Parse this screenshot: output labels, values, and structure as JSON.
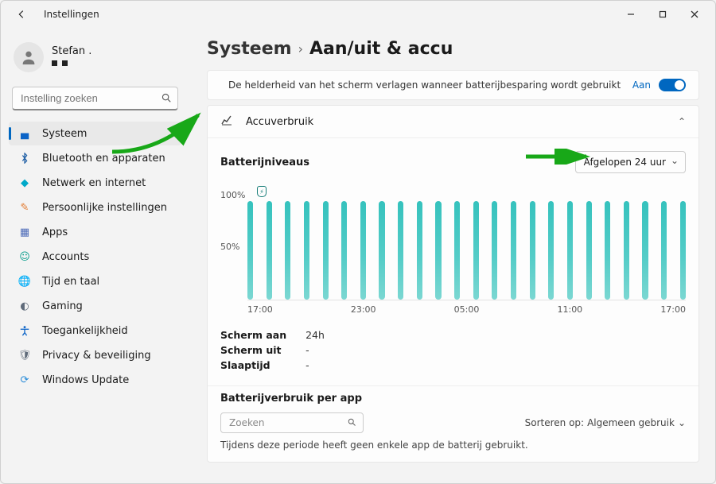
{
  "titlebar": {
    "title": "Instellingen"
  },
  "account": {
    "name": "Stefan ."
  },
  "search": {
    "placeholder": "Instelling zoeken"
  },
  "nav": {
    "items": [
      {
        "label": "Systeem"
      },
      {
        "label": "Bluetooth en apparaten"
      },
      {
        "label": "Netwerk en internet"
      },
      {
        "label": "Persoonlijke instellingen"
      },
      {
        "label": "Apps"
      },
      {
        "label": "Accounts"
      },
      {
        "label": "Tijd en taal"
      },
      {
        "label": "Gaming"
      },
      {
        "label": "Toegankelijkheid"
      },
      {
        "label": "Privacy & beveiliging"
      },
      {
        "label": "Windows Update"
      }
    ]
  },
  "breadcrumb": {
    "parent": "Systeem",
    "current": "Aan/uit & accu"
  },
  "brightness_saver": {
    "label": "De helderheid van het scherm verlagen wanneer batterijbesparing wordt gebruikt",
    "state_label": "Aan",
    "on": true
  },
  "usage_header": {
    "label": "Accuverbruik"
  },
  "levels": {
    "title": "Batterijniveaus",
    "range_label": "Afgelopen 24 uur"
  },
  "kv": {
    "labels": {
      "on": "Scherm aan",
      "off": "Scherm uit",
      "sleep": "Slaaptijd"
    },
    "values": {
      "on": "24h",
      "off": "-",
      "sleep": "-"
    }
  },
  "apps": {
    "title": "Batterijverbruik per app",
    "search_placeholder": "Zoeken",
    "sort_label": "Sorteren op:",
    "sort_value": "Algemeen gebruik",
    "empty_message": "Tijdens deze periode heeft geen enkele app de batterij gebruikt."
  },
  "chart_data": {
    "type": "bar",
    "title": "Batterijniveaus",
    "ylabel": "%",
    "ylim": [
      0,
      100
    ],
    "y_ticks": [
      "100%",
      "50%"
    ],
    "x_ticks": [
      "17:00",
      "23:00",
      "05:00",
      "11:00",
      "17:00"
    ],
    "bars_count": 24,
    "values": [
      100,
      100,
      100,
      100,
      100,
      100,
      100,
      100,
      100,
      100,
      100,
      100,
      100,
      100,
      100,
      100,
      100,
      100,
      100,
      100,
      100,
      100,
      100,
      100
    ],
    "charging_marker_index": 1
  }
}
